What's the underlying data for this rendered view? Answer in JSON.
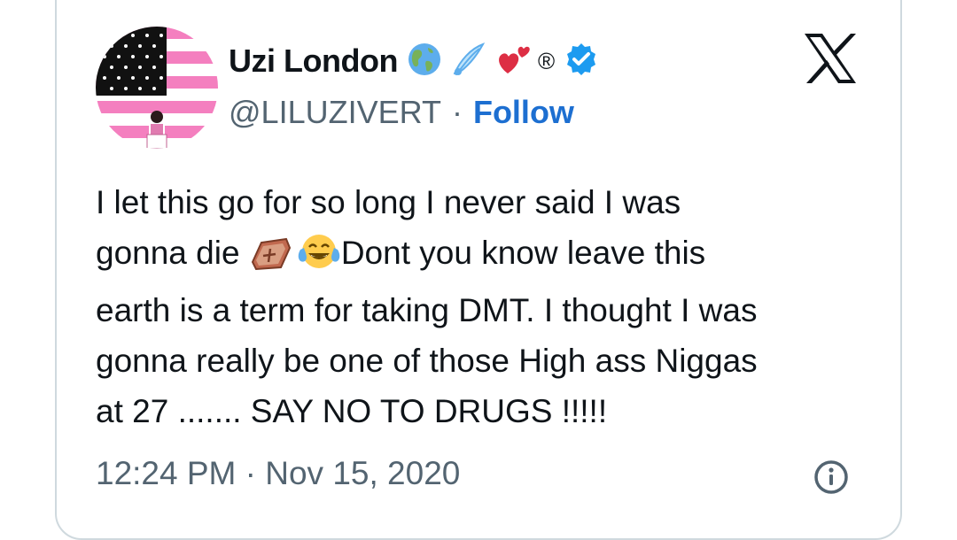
{
  "tweet": {
    "display_name": "Uzi London",
    "handle": "@LILUZIVERT",
    "separator": "·",
    "follow_label": "Follow",
    "registered_mark": "®",
    "name_emojis": [
      "globe-americas-icon",
      "comet-icon",
      "two-hearts-icon",
      "registered-icon",
      "verified-badge-icon"
    ],
    "body_lines": [
      "I let this go for so long I never said I was",
      "gonna die",
      "Dont you know leave this",
      "earth is a term for taking DMT.  I thought I was",
      "gonna really be one of those High ass Niggas",
      "at 27 ....... SAY NO TO DRUGS !!!!!"
    ],
    "timestamp": "12:24 PM · Nov 15, 2020"
  },
  "colors": {
    "text": "#0f1419",
    "muted": "#536471",
    "follow": "#1d6fd1",
    "verified": "#1d9bf0",
    "border": "#cfd9de",
    "flag_pink": "#f47fbf"
  }
}
